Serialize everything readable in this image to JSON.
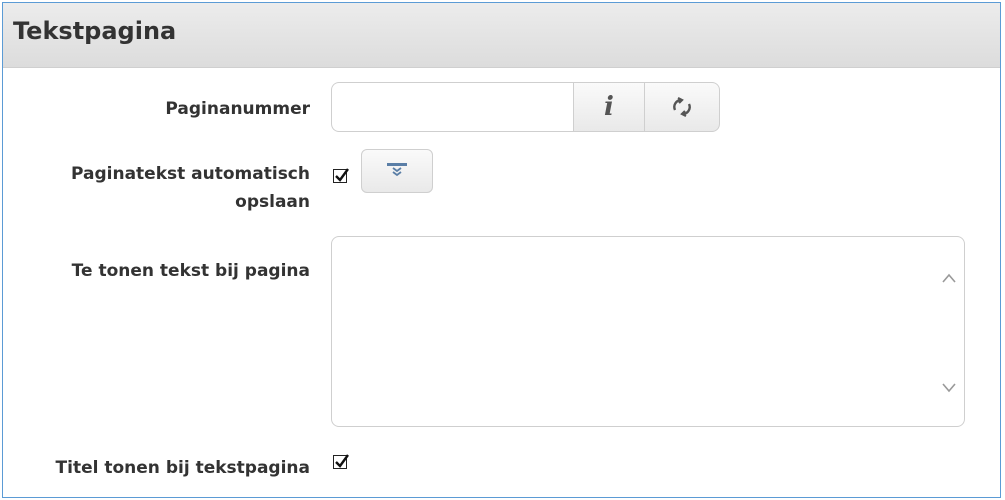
{
  "panel": {
    "title": "Tekstpagina"
  },
  "fields": {
    "page_number": {
      "label": "Paginanummer",
      "value": "",
      "info_icon": "info-icon",
      "refresh_icon": "refresh-icon"
    },
    "autosave": {
      "label_line1": "Paginatekst automatisch",
      "label_line2": "opslaan",
      "checked": true,
      "collapse_icon": "collapse-arrow-icon"
    },
    "page_text": {
      "label": "Te tonen tekst bij pagina",
      "value": ""
    },
    "show_title": {
      "label": "Titel tonen bij tekstpagina",
      "checked": true
    }
  },
  "colors": {
    "border": "#5b9bd5",
    "header_bg": "#e0e0e0",
    "text": "#333333"
  }
}
